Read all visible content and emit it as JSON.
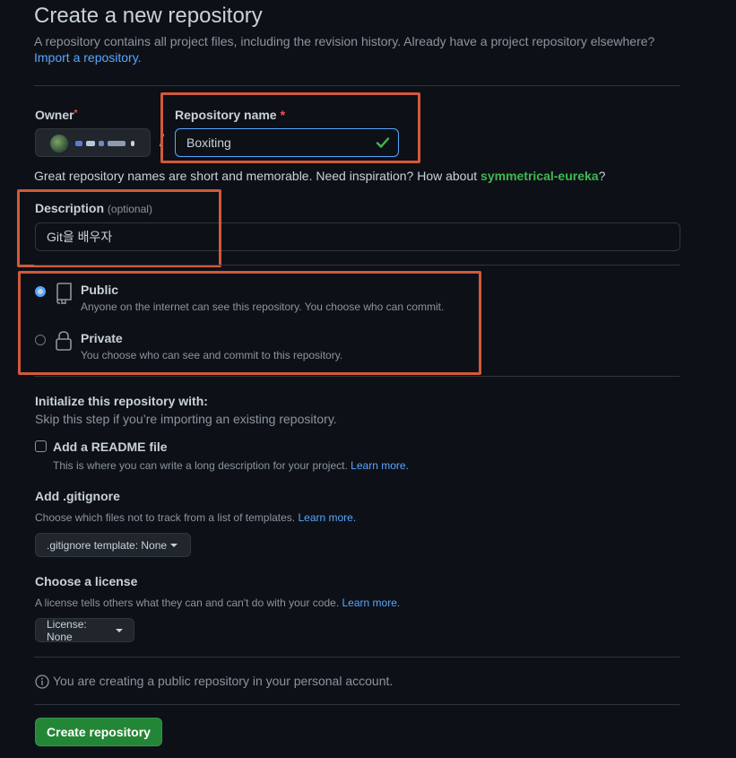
{
  "header": {
    "title": "Create a new repository",
    "subtitle": "A repository contains all project files, including the revision history. Already have a project repository elsewhere?",
    "import_link": "Import a repository."
  },
  "owner": {
    "label": "Owner",
    "required_mark": "*"
  },
  "repo_name": {
    "label": "Repository name",
    "required_mark": "*",
    "value": "Boxiting"
  },
  "suggestion": {
    "text": "Great repository names are short and memorable. Need inspiration? How about",
    "name": "symmetrical-eureka",
    "end": "?"
  },
  "description": {
    "label": "Description",
    "optional": "(optional)",
    "value": "Git을 배우자"
  },
  "visibility": {
    "public": {
      "title": "Public",
      "desc": "Anyone on the internet can see this repository. You choose who can commit.",
      "checked": true
    },
    "private": {
      "title": "Private",
      "desc": "You choose who can see and commit to this repository.",
      "checked": false
    }
  },
  "init": {
    "title": "Initialize this repository with:",
    "subtitle": "Skip this step if you’re importing an existing repository.",
    "readme": {
      "label": "Add a README file",
      "desc": "This is where you can write a long description for your project.",
      "learn": "Learn more."
    }
  },
  "gitignore": {
    "title": "Add .gitignore",
    "desc": "Choose which files not to track from a list of templates.",
    "learn": "Learn more.",
    "button": ".gitignore template: None"
  },
  "license": {
    "title": "Choose a license",
    "desc": "A license tells others what they can and can't do with your code.",
    "learn": "Learn more.",
    "button": "License: None"
  },
  "notice": "You are creating a public repository in your personal account.",
  "submit": "Create repository",
  "colors": {
    "accent": "#58a6ff",
    "success": "#238636",
    "annotation": "#d2593b",
    "danger": "#f85149"
  }
}
